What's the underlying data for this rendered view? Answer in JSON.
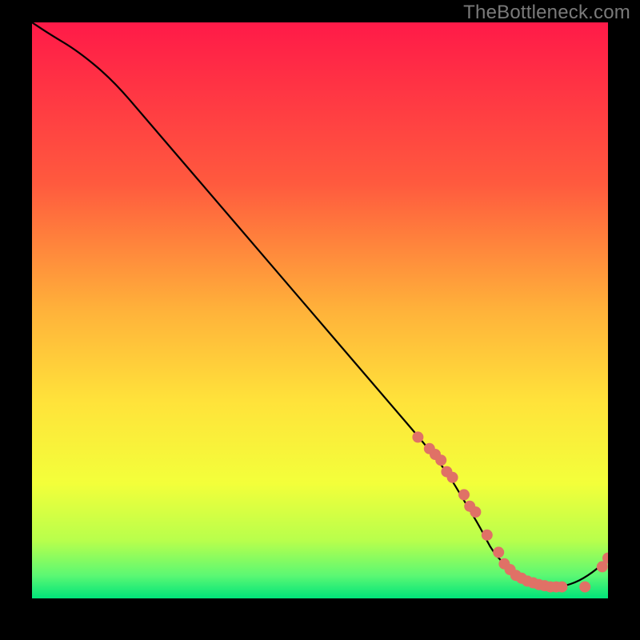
{
  "watermark": "TheBottleneck.com",
  "colors": {
    "gradient_top": "#ff1a48",
    "gradient_mid_upper": "#ff7a3a",
    "gradient_mid": "#ffd438",
    "gradient_mid_lower": "#f6ff3a",
    "gradient_lower": "#94ff5f",
    "gradient_bottom": "#00e47a",
    "curve": "#000000",
    "marker": "#e07166",
    "background": "#000000"
  },
  "chart_data": {
    "type": "line",
    "title": "",
    "xlabel": "",
    "ylabel": "",
    "xlim": [
      0,
      100
    ],
    "ylim": [
      0,
      100
    ],
    "grid": false,
    "legend": false,
    "series": [
      {
        "name": "bottleneck-curve",
        "x": [
          0,
          3,
          8,
          14,
          20,
          26,
          32,
          38,
          44,
          50,
          56,
          62,
          68,
          72,
          75,
          78,
          80,
          83,
          86,
          88,
          90,
          92,
          95,
          98,
          100
        ],
        "y": [
          100,
          98,
          95,
          90,
          83,
          76,
          69,
          62,
          55,
          48,
          41,
          34,
          27,
          22,
          17,
          12,
          8,
          5,
          3,
          2,
          2,
          2,
          3,
          5,
          7
        ]
      }
    ],
    "markers": {
      "name": "highlighted-points",
      "x": [
        67,
        69,
        70,
        71,
        72,
        73,
        75,
        76,
        77,
        79,
        81,
        82,
        83,
        84,
        85,
        86,
        87,
        88,
        89,
        90,
        91,
        92,
        96,
        99,
        100
      ],
      "y": [
        28,
        26,
        25,
        24,
        22,
        21,
        18,
        16,
        15,
        11,
        8,
        6,
        5,
        4,
        3.5,
        3,
        2.7,
        2.4,
        2.2,
        2,
        2,
        2,
        2,
        5.5,
        7
      ]
    }
  }
}
